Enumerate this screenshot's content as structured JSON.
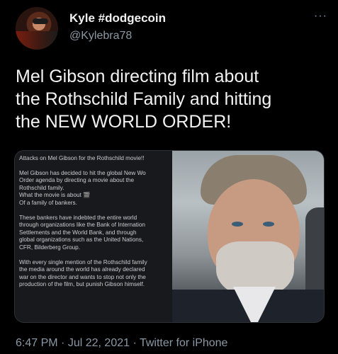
{
  "user": {
    "name": "Kyle #dodgecoin",
    "handle": "@Kylebra78"
  },
  "more_label": "···",
  "tweet": {
    "lines": [
      "Mel Gibson directing film about",
      "the Rothschild Family and hitting",
      "the NEW WORLD ORDER!"
    ]
  },
  "media": {
    "screenshot_lines": [
      "Attacks on Mel Gibson for the Rothschild movie!!",
      "",
      "Mel Gibson has decided to hit the global New Wo",
      "Order agenda by directing a movie about the",
      "Rothschild family.",
      "What the movie is about 🎬",
      "Of a family of bankers.",
      "",
      "These bankers have indebted the entire world",
      "through organizations like the Bank of Internation",
      "Settlements and the World Bank, and through",
      "global organizations such as the United Nations,",
      "CFR, Bilderberg Group.",
      "",
      "With every single mention of the Rothschild family",
      "the media around the world has already declared",
      "war on the director and wants to stop not only the",
      "production of the film, but punish Gibson himself."
    ]
  },
  "footer": {
    "time": "6:47 PM",
    "date": "Jul 22, 2021",
    "source": "Twitter for iPhone",
    "separator": "·"
  }
}
